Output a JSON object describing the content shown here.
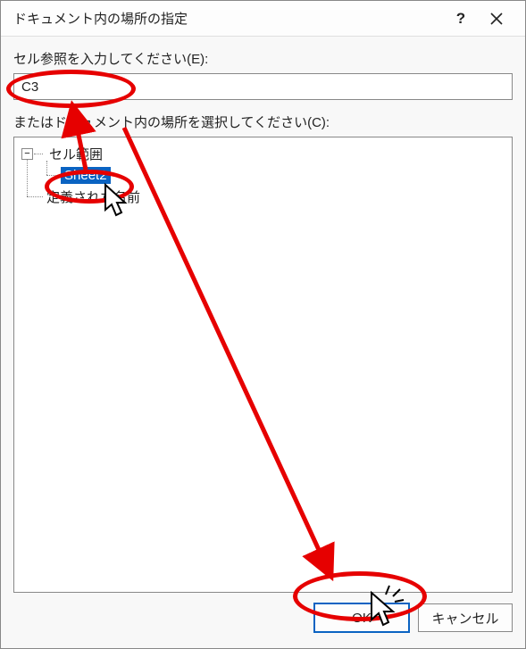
{
  "titlebar": {
    "title": "ドキュメント内の場所の指定",
    "help": "?",
    "close": "×"
  },
  "labels": {
    "cell_ref": "セル参照を入力してください(E):",
    "doc_place": "またはドキュメント内の場所を選択してください(C):"
  },
  "input": {
    "cell_ref_value": "C3"
  },
  "tree": {
    "root": {
      "label": "セル範囲",
      "expanded": true
    },
    "children": [
      {
        "label": "Sheet2",
        "selected": true
      }
    ],
    "sibling": {
      "label": "定義された名前"
    }
  },
  "buttons": {
    "ok": "OK",
    "cancel": "キャンセル"
  },
  "annotations": {
    "color": "#e60000"
  }
}
